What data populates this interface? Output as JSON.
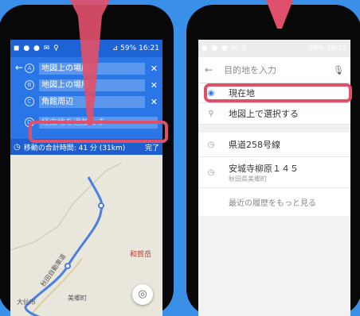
{
  "left_phone": {
    "status": {
      "icons": "◼ ● ● ✉ ♀",
      "signal": "⊿ 59%",
      "time": "16:21"
    },
    "waypoints": [
      {
        "marker": "A",
        "text": "地図上の場所"
      },
      {
        "marker": "B",
        "text": "地図上の場所"
      },
      {
        "marker": "C",
        "text": "角館周辺"
      },
      {
        "marker": "D",
        "text": "経由地を追加しま"
      }
    ],
    "total_time": "移動の合計時間: 41 分 (31km)",
    "done_label": "完了",
    "map_labels": {
      "akita_highway": "秋田自動車道",
      "daisen": "大仙市",
      "misato": "美郷町",
      "waga": "和賀岳"
    }
  },
  "right_phone": {
    "status": {
      "icons": "◼ ● ● ✉ ♀",
      "signal": "59%",
      "time": "16:22"
    },
    "search_placeholder": "目的地を入力",
    "current_location": "現在地",
    "select_on_map": "地図上で選択する",
    "history": [
      {
        "title": "県道258号線",
        "sub": ""
      },
      {
        "title": "安城寺柳原１４５",
        "sub": "秋田県美郷町"
      }
    ],
    "more_history": "最近の履歴をもっと見る"
  },
  "colors": {
    "highlight": "#e0506a",
    "background": "#3a90e8",
    "route": "#4a80e0"
  }
}
